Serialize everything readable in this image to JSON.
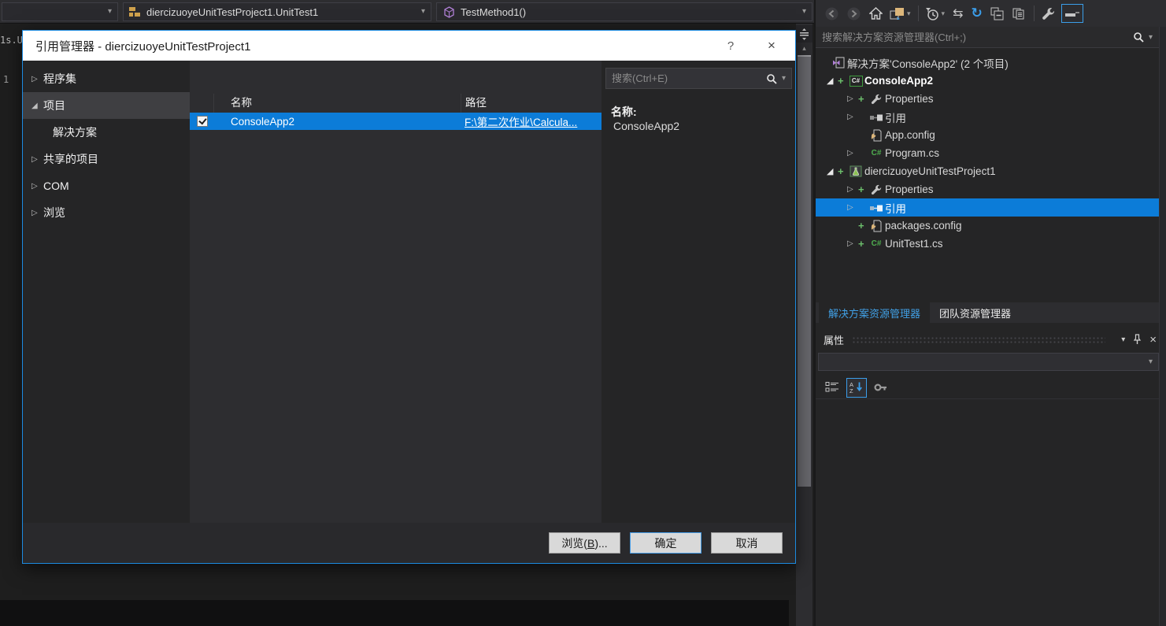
{
  "glyphs": {
    "dropdown_arrow": "▾",
    "expander_collapsed": "▷",
    "expander_expanded": "◢",
    "pending_add": "+",
    "sync": "⇆",
    "refresh": "↻",
    "scroll_up_arrow": "▴",
    "help": "?",
    "close": "×"
  },
  "nav_bar": {
    "context_dropdown": "",
    "class_dropdown": "diercizuoyeUnitTestProject1.UnitTest1",
    "member_dropdown": "TestMethod1()"
  },
  "editor": {
    "code_fragment": "1s.U",
    "line_number": "1"
  },
  "dialog": {
    "title": "引用管理器 - diercizuoyeUnitTestProject1",
    "sidebar": [
      {
        "label": "程序集"
      },
      {
        "label": "项目",
        "selected": true,
        "expanded": true
      },
      {
        "label": "解决方案",
        "child": true
      },
      {
        "label": "共享的项目"
      },
      {
        "label": "COM"
      },
      {
        "label": "浏览"
      }
    ],
    "list": {
      "col_name": "名称",
      "col_path": "路径",
      "rows": [
        {
          "name": "ConsoleApp2",
          "path": "F:\\第二次作业\\Calcula...",
          "checked": true,
          "selected": true
        }
      ]
    },
    "search_placeholder": "搜索(Ctrl+E)",
    "detail": {
      "name_label": "名称:",
      "name_value": "ConsoleApp2"
    },
    "footer": {
      "browse_prefix": "浏览(",
      "browse_key": "B",
      "browse_suffix": ")...",
      "ok": "确定",
      "cancel": "取消"
    }
  },
  "solution_explorer": {
    "search_placeholder": "搜索解决方案资源管理器(Ctrl+;)",
    "tree": [
      {
        "label": "解决方案'ConsoleApp2' (2 个项目)",
        "icon": "solution-icon"
      },
      {
        "label": "ConsoleApp2",
        "icon": "csharp-project-icon",
        "bold": true,
        "expanded": true,
        "pending_add": true
      },
      {
        "label": "Properties",
        "icon": "properties-wrench-icon",
        "pending_add": true
      },
      {
        "label": "引用",
        "icon": "references-icon"
      },
      {
        "label": "App.config",
        "icon": "config-file-icon"
      },
      {
        "label": "Program.cs",
        "icon": "csharp-file-icon"
      },
      {
        "label": "diercizuoyeUnitTestProject1",
        "icon": "test-project-icon",
        "expanded": true,
        "pending_add": true
      },
      {
        "label": "Properties",
        "icon": "properties-wrench-icon",
        "pending_add": true
      },
      {
        "label": "引用",
        "icon": "references-icon",
        "selected": true
      },
      {
        "label": "packages.config",
        "icon": "config-file-icon",
        "pending_add": true
      },
      {
        "label": "UnitTest1.cs",
        "icon": "csharp-file-icon",
        "pending_add": true
      }
    ],
    "tabs": [
      {
        "label": "解决方案资源管理器",
        "active": true
      },
      {
        "label": "团队资源管理器"
      }
    ]
  },
  "properties_panel": {
    "title": "属性"
  },
  "colors": {
    "selection_blue": "#0c7cd8",
    "dialog_border": "#1c8ae0",
    "title_bar": "#ffffff",
    "pending_add_green": "#6cbe6c",
    "active_tab_text": "#41a0e5",
    "panel_bg": "#252526",
    "toolbar_bg": "#2d2d30"
  }
}
